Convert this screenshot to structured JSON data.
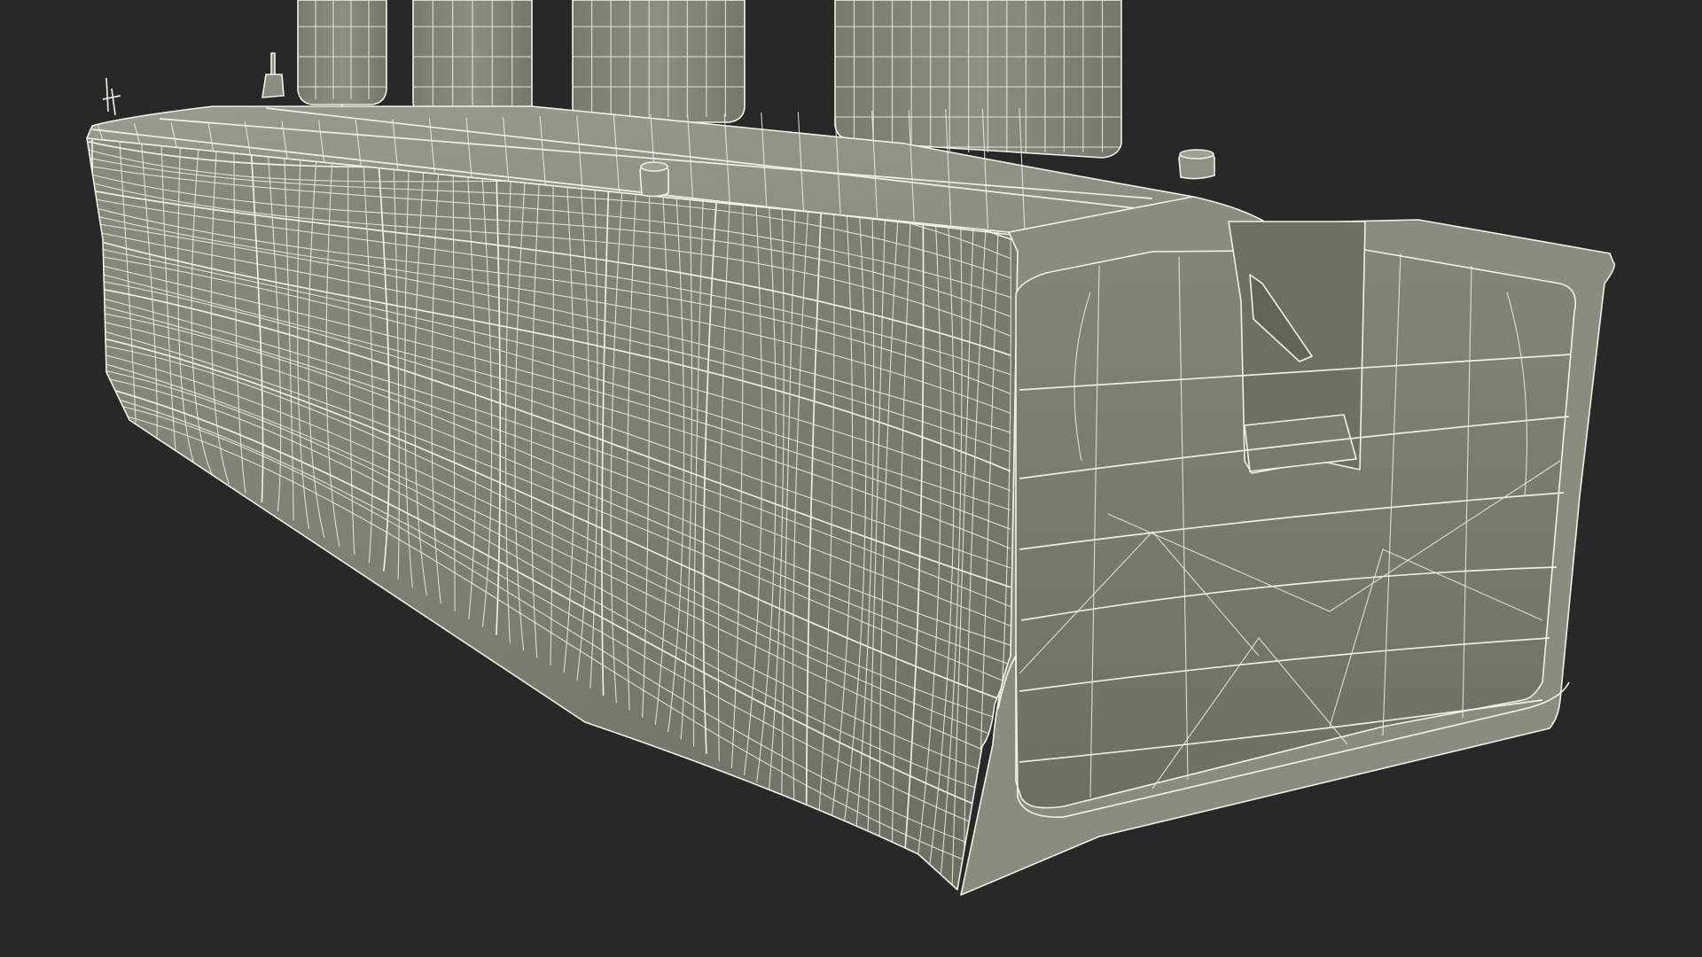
{
  "scene": {
    "subject": "",
    "render_style": "wireframe-over-clay",
    "colors": {
      "background": "#282828",
      "clay_light": "#8f8f84",
      "clay_mid": "#7d7d72",
      "clay_dark": "#66665c",
      "wire": "#efeee3"
    }
  }
}
